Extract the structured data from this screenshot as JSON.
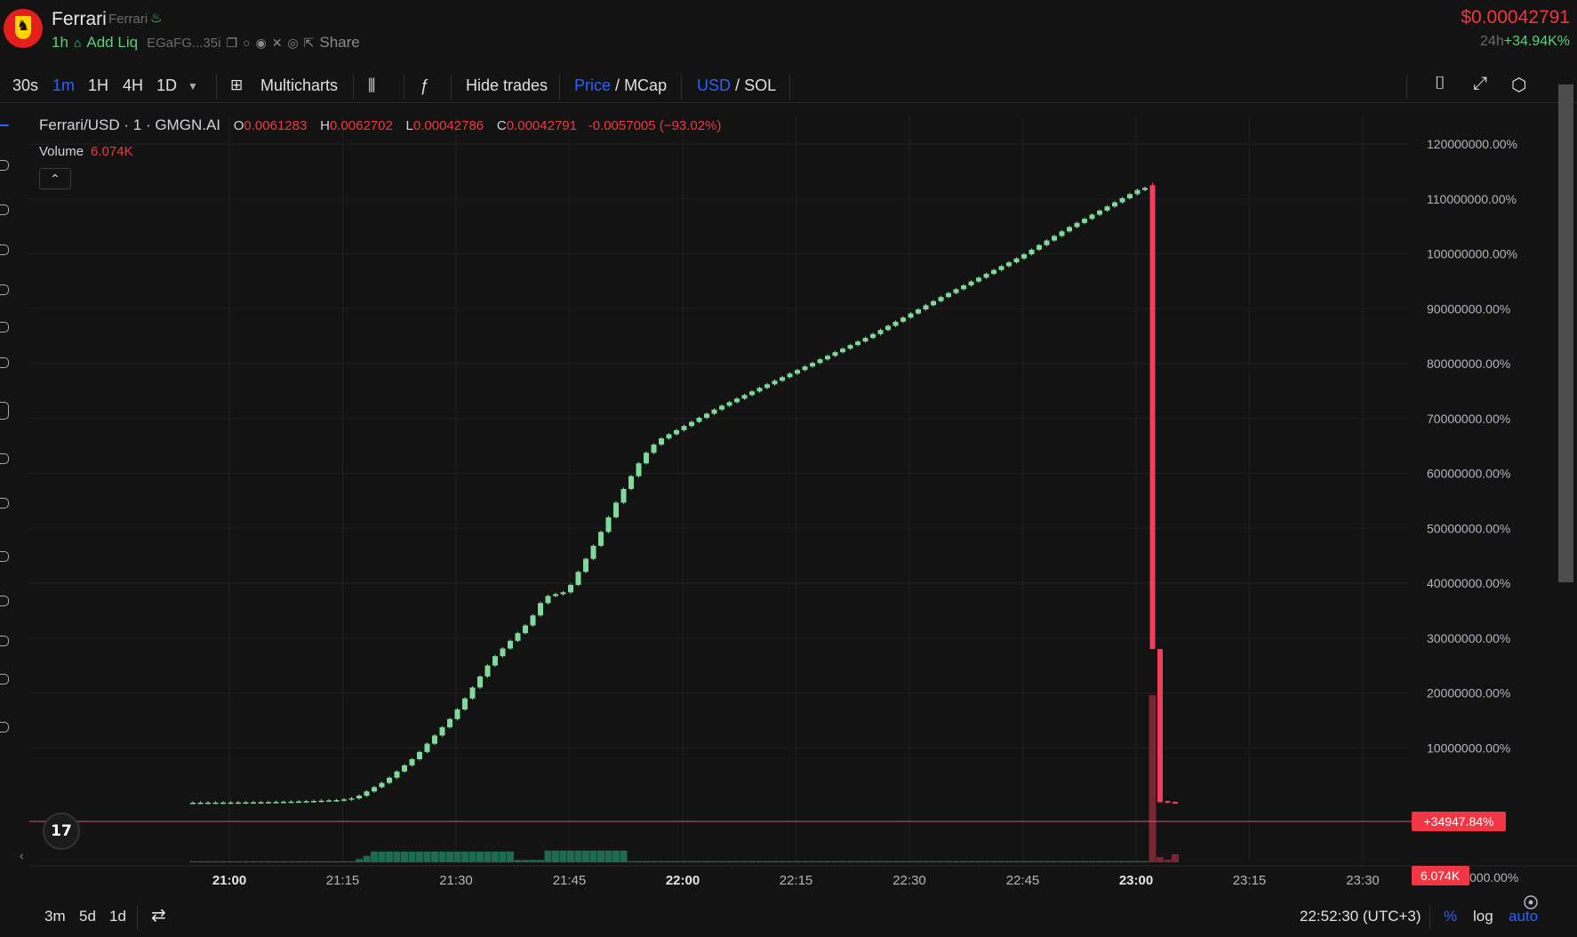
{
  "header": {
    "token_name": "Ferrari",
    "token_subname": "Ferrari",
    "age": "1h",
    "add_liq": "Add Liq",
    "address": "EGaFG...35i",
    "share": "Share",
    "price": "$0.00042791",
    "change_period": "24h",
    "change_value": "+34.94K%"
  },
  "toolbar": {
    "intervals": [
      "30s",
      "1m",
      "1H",
      "4H",
      "1D"
    ],
    "active_interval": "1m",
    "multicharts": "Multicharts",
    "hide_trades": "Hide trades",
    "price": "Price",
    "mcap": "MCap",
    "usd": "USD",
    "sol": "SOL",
    "slash": "/"
  },
  "legend": {
    "title": "Ferrari/USD · 1 · GMGN.AI",
    "o_label": "O",
    "o_value": "0.0061283",
    "h_label": "H",
    "h_value": "0.0062702",
    "l_label": "L",
    "l_value": "0.00042786",
    "c_label": "C",
    "c_value": "0.00042791",
    "change": "-0.0057005 (−93.02%)",
    "volume_label": "Volume",
    "volume_value": "6.074K"
  },
  "chart_data": {
    "type": "candlestick",
    "title": "Ferrari/USD · 1 · GMGN.AI",
    "x_unit": "minutes since 20:55 (UTC+3)",
    "y_unit": "% change",
    "ylim": [
      0,
      125000000
    ],
    "y_ticks": [
      "120000000.00%",
      "110000000.00%",
      "100000000.00%",
      "90000000.00%",
      "80000000.00%",
      "70000000.00%",
      "60000000.00%",
      "50000000.00%",
      "40000000.00%",
      "30000000.00%",
      "20000000.00%",
      "10000000.00%"
    ],
    "x_ticks": [
      "21:00",
      "21:15",
      "21:30",
      "21:45",
      "22:00",
      "22:15",
      "22:30",
      "22:45",
      "23:00",
      "23:15",
      "23:30"
    ],
    "x_tick_bold": [
      "21:00",
      "22:00",
      "23:00"
    ],
    "current_label": "+34947.84%",
    "volume_label": "6.074K",
    "volume_axis_label": "000.00%",
    "grid": true,
    "up_color": "#7fd99b",
    "down_color": "#f23d5c",
    "volume_up_color": "#1f6a52",
    "volume_down_color": "#7a2533",
    "anchors": [
      [
        0,
        0
      ],
      [
        5,
        40000
      ],
      [
        10,
        100000
      ],
      [
        15,
        250000
      ],
      [
        20,
        500000
      ],
      [
        22,
        900000
      ],
      [
        26,
        4000000
      ],
      [
        30,
        8500000
      ],
      [
        35,
        16000000
      ],
      [
        40,
        26000000
      ],
      [
        45,
        33000000
      ],
      [
        47,
        37500000
      ],
      [
        50,
        38500000
      ],
      [
        54,
        48000000
      ],
      [
        57,
        56000000
      ],
      [
        60,
        63000000
      ],
      [
        62,
        66000000
      ],
      [
        70,
        72000000
      ],
      [
        80,
        78500000
      ],
      [
        90,
        85000000
      ],
      [
        100,
        92500000
      ],
      [
        110,
        99500000
      ],
      [
        116,
        104500000
      ],
      [
        122,
        109000000
      ],
      [
        126,
        112000000
      ]
    ],
    "crash": {
      "t": 127,
      "open": 112500000,
      "close": 28000000,
      "high": 113000000,
      "low": 28000000
    },
    "after": [
      {
        "t": 128,
        "open": 28000000,
        "close": 100000,
        "high": 28000000,
        "low": 50000
      },
      {
        "t": 129,
        "open": 300000,
        "close": 150000,
        "high": 400000,
        "low": 100000
      },
      {
        "t": 130,
        "open": 150000,
        "close": 35000,
        "high": 200000,
        "low": 30000
      }
    ],
    "volumes": {
      "flat_minutes": [
        0,
        21
      ],
      "flat_level": 0.05,
      "mid_minutes": [
        22,
        42
      ],
      "mid_level": 0.55,
      "gap_minutes": [
        43,
        46
      ],
      "gap_level": 0.12,
      "block_minutes": [
        47,
        57
      ],
      "block_level": 0.6,
      "tail_minutes": [
        58,
        126
      ],
      "tail_level": 0.06,
      "crash_volume": 1.0,
      "after_volumes": [
        0.1,
        0.05,
        0.15
      ]
    }
  },
  "bottom": {
    "ranges": [
      "3m",
      "5d",
      "1d"
    ],
    "time": "22:52:30 (UTC+3)",
    "percent": "%",
    "log": "log",
    "auto": "auto"
  },
  "icons": {
    "fire": "🔥",
    "camera": "camera-icon",
    "fullscreen": "fullscreen-icon",
    "settings": "settings-icon"
  }
}
